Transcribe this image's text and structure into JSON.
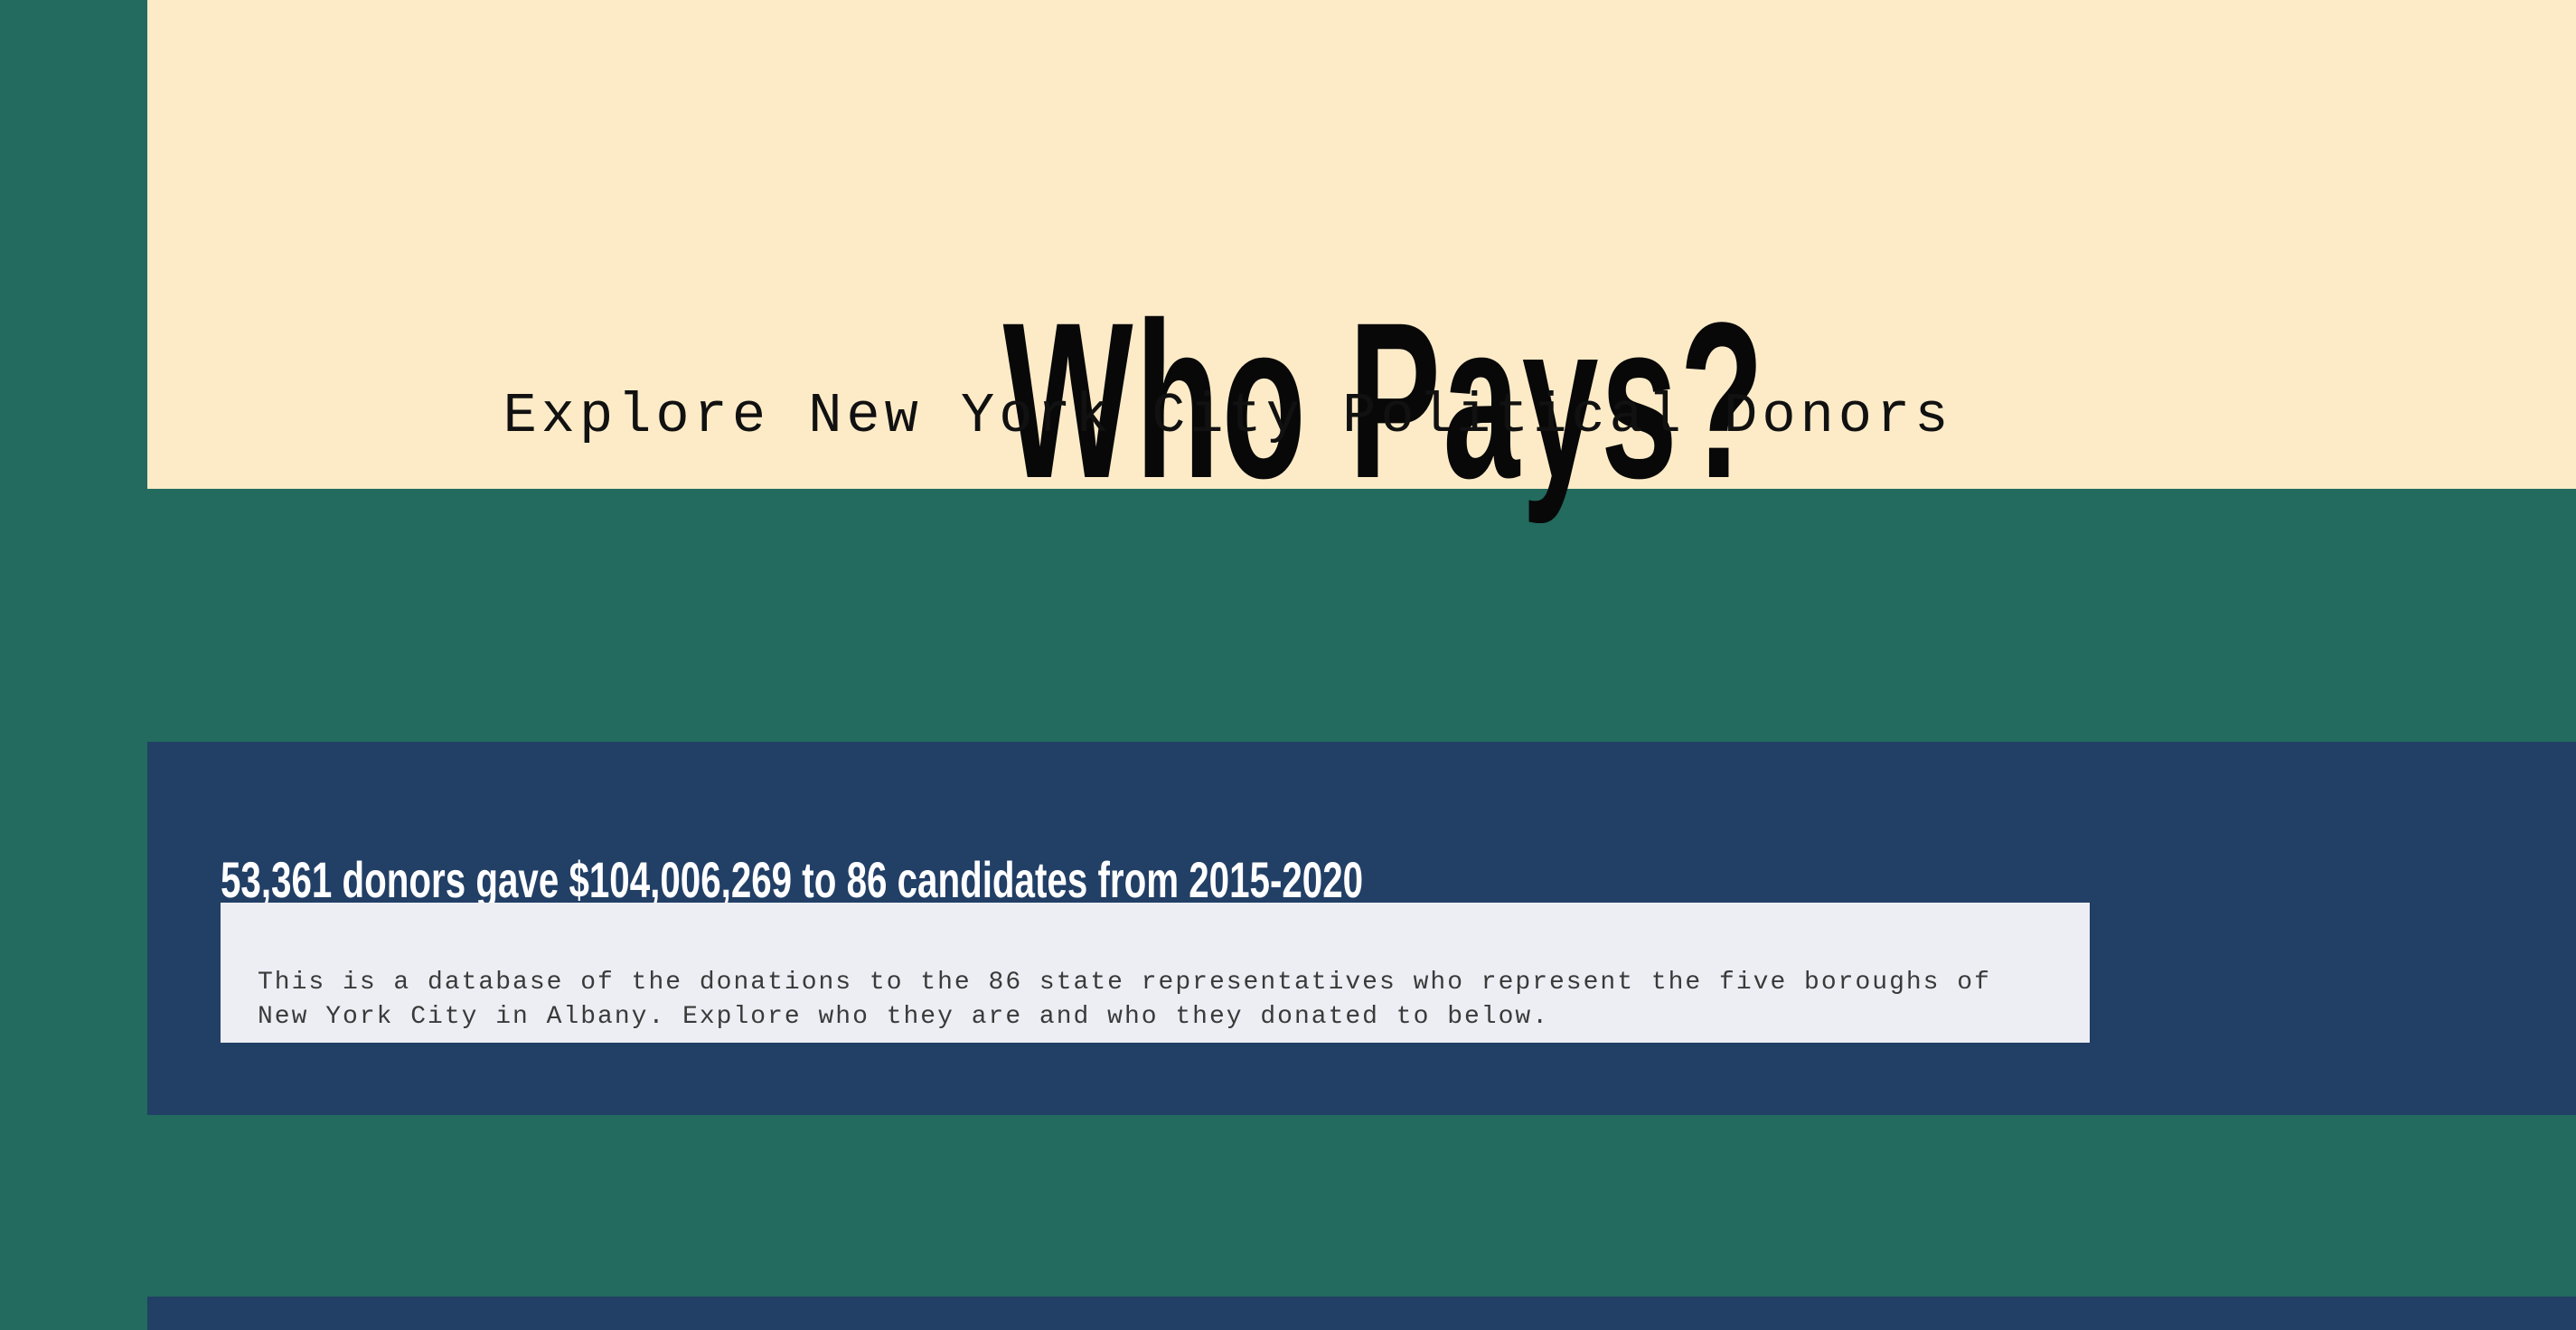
{
  "hero": {
    "title": "Who Pays?",
    "subtitle": "Explore New York City Political Donors"
  },
  "summary": {
    "heading": "53,361 donors gave $104,006,269 to 86 candidates from 2015-2020",
    "description": "This is a database of the donations to the 86 state representatives who represent the five boroughs of New York City in Albany. Explore who they are and who they donated to below."
  },
  "colors": {
    "page_background": "#226b5e",
    "hero_background": "#fdebc8",
    "band_background": "#223f66",
    "description_background": "#eceef3"
  }
}
